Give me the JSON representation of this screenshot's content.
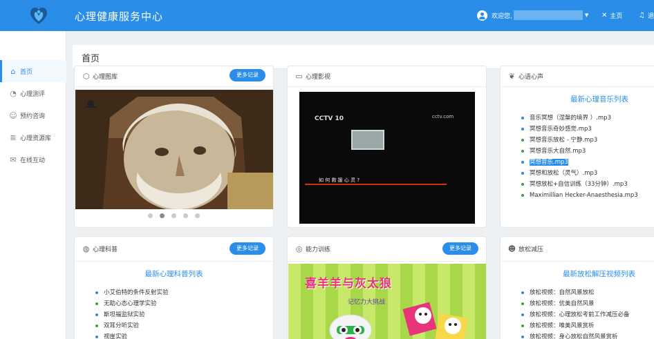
{
  "header": {
    "app_title": "心理健康服务中心",
    "welcome": "欢迎您,",
    "home_label": "主页",
    "right_label": "退"
  },
  "sidebar": {
    "items": [
      {
        "label": "首页",
        "icon": "home-icon"
      },
      {
        "label": "心理测评",
        "icon": "gauge-icon"
      },
      {
        "label": "预约咨询",
        "icon": "smile-icon"
      },
      {
        "label": "心理资源库",
        "icon": "database-icon"
      },
      {
        "label": "在线互动",
        "icon": "mail-icon"
      }
    ]
  },
  "page": {
    "title": "首页"
  },
  "cards": {
    "gallery": {
      "title": "心理图库",
      "more": "更多记录"
    },
    "video": {
      "title": "心理影视",
      "channel": "CCTV 10",
      "site": "cctv.com",
      "subtitle": "如 何 救 援 心 灵 ?"
    },
    "voice": {
      "title": "心语心声",
      "list_title": "最新心理音乐列表",
      "items": [
        "音乐冥想（涅槃的境界 ）.mp3",
        "冥想音乐奇妙感觉.mp3",
        "冥想音乐放松 - 宁静.mp3",
        "冥想音乐大自然.mp3",
        "冥想音乐.mp3",
        "冥想和放松（灵气）.mp3",
        "冥想放松+自信训练（33分钟）.mp3",
        "Maximillian Hecker-Anaesthesia.mp3"
      ]
    },
    "science": {
      "title": "心理科普",
      "more": "更多记录",
      "list_title": "最新心理科普列表",
      "items": [
        "小艾伯特的条件反射实验",
        "无助心态心理学实验",
        "斯坦福监狱实验",
        "双耳分听实验",
        "视崖实验"
      ]
    },
    "training": {
      "title": "能力训练",
      "more": "更多记录",
      "banner_title": "喜羊羊与灰太狼",
      "banner_sub": "记忆力大挑战"
    },
    "relax": {
      "title": "放松减压",
      "list_title": "最新放松解压视频列表",
      "items": [
        "放松视频：自然风景放松",
        "放松视频：优美自然风景",
        "放松视频：心理放松考前工作减压必备",
        "放松视频：唯美风景赏析",
        "放松视频：身心放松自然风景赏析"
      ]
    }
  },
  "colors": {
    "primary": "#2a8ee8",
    "green_bullet": "#27a844",
    "background": "#eef1f4"
  }
}
